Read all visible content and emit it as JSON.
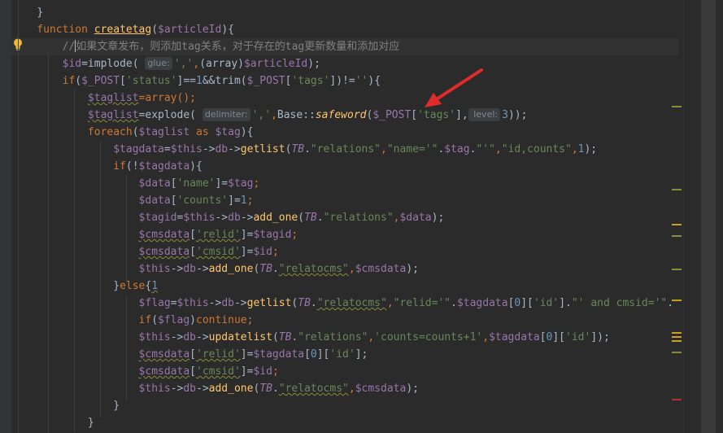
{
  "editor": {
    "lines": [
      {
        "tokens": [
          {
            "t": "    ",
            "c": "plain"
          },
          {
            "t": "}",
            "c": "plain"
          }
        ]
      },
      {
        "tokens": [
          {
            "t": "    ",
            "c": "plain"
          },
          {
            "t": "function ",
            "c": "kw"
          },
          {
            "t": "createtag",
            "c": "ul-fn"
          },
          {
            "t": "(",
            "c": "plain"
          },
          {
            "t": "$articleId",
            "c": "var"
          },
          {
            "t": "){",
            "c": "plain"
          }
        ]
      },
      {
        "current": true,
        "tokens": [
          {
            "t": "        ",
            "c": "plain"
          },
          {
            "t": "//",
            "c": "cmt"
          },
          {
            "t": "CARET",
            "c": "caret"
          },
          {
            "t": "如果文章发布，则添加tag关系，对于存在的tag更新数量和添加对应",
            "c": "cmt"
          }
        ]
      },
      {
        "tokens": [
          {
            "t": "        ",
            "c": "plain"
          },
          {
            "t": "$id",
            "c": "var"
          },
          {
            "t": "=implode( ",
            "c": "plain"
          },
          {
            "t": "glue:",
            "c": "hint"
          },
          {
            "t": "','",
            "c": "str"
          },
          {
            "t": ",",
            "c": "kw"
          },
          {
            "t": "(array)",
            "c": "plain"
          },
          {
            "t": "$articleId",
            "c": "var"
          },
          {
            "t": ");",
            "c": "plain"
          }
        ]
      },
      {
        "tokens": [
          {
            "t": "        ",
            "c": "plain"
          },
          {
            "t": "if",
            "c": "kw"
          },
          {
            "t": "(",
            "c": "plain"
          },
          {
            "t": "$_POST",
            "c": "var"
          },
          {
            "t": "[",
            "c": "plain"
          },
          {
            "t": "'status'",
            "c": "str"
          },
          {
            "t": "]==",
            "c": "plain"
          },
          {
            "t": "1",
            "c": "num"
          },
          {
            "t": "&&trim(",
            "c": "plain"
          },
          {
            "t": "$_POST",
            "c": "var"
          },
          {
            "t": "[",
            "c": "plain"
          },
          {
            "t": "'tags'",
            "c": "str"
          },
          {
            "t": "])!=",
            "c": "plain"
          },
          {
            "t": "''",
            "c": "str"
          },
          {
            "t": "){",
            "c": "plain"
          }
        ]
      },
      {
        "tokens": [
          {
            "t": "            ",
            "c": "plain"
          },
          {
            "t": "$taglist",
            "c": "var squig"
          },
          {
            "t": "=array();",
            "c": "kw"
          }
        ]
      },
      {
        "tokens": [
          {
            "t": "            ",
            "c": "plain"
          },
          {
            "t": "$taglist",
            "c": "var squig"
          },
          {
            "t": "=explode( ",
            "c": "plain"
          },
          {
            "t": "delimiter:",
            "c": "hint"
          },
          {
            "t": "','",
            "c": "str"
          },
          {
            "t": ",",
            "c": "kw"
          },
          {
            "t": "Base::",
            "c": "plain"
          },
          {
            "t": "safeword",
            "c": "ital-fn"
          },
          {
            "t": "(",
            "c": "plain"
          },
          {
            "t": "$_POST",
            "c": "var"
          },
          {
            "t": "[",
            "c": "plain"
          },
          {
            "t": "'tags'",
            "c": "str"
          },
          {
            "t": "],",
            "c": "plain"
          },
          {
            "t": " level:",
            "c": "hint"
          },
          {
            "t": "3",
            "c": "num"
          },
          {
            "t": "));",
            "c": "plain"
          }
        ]
      },
      {
        "tokens": [
          {
            "t": "            ",
            "c": "plain"
          },
          {
            "t": "foreach",
            "c": "kw"
          },
          {
            "t": "(",
            "c": "plain"
          },
          {
            "t": "$taglist",
            "c": "var"
          },
          {
            "t": " as ",
            "c": "kw"
          },
          {
            "t": "$tag",
            "c": "var"
          },
          {
            "t": "){",
            "c": "plain"
          }
        ]
      },
      {
        "tokens": [
          {
            "t": "                ",
            "c": "plain"
          },
          {
            "t": "$tagdata",
            "c": "var"
          },
          {
            "t": "=",
            "c": "plain"
          },
          {
            "t": "$this",
            "c": "var"
          },
          {
            "t": "->",
            "c": "plain"
          },
          {
            "t": "db",
            "c": "var"
          },
          {
            "t": "->",
            "c": "plain"
          },
          {
            "t": "getlist",
            "c": "method"
          },
          {
            "t": "(",
            "c": "plain"
          },
          {
            "t": "TB",
            "c": "const"
          },
          {
            "t": ".",
            "c": "plain"
          },
          {
            "t": "\"relations\"",
            "c": "str"
          },
          {
            "t": ",",
            "c": "kw"
          },
          {
            "t": "\"name='\"",
            "c": "str"
          },
          {
            "t": ".",
            "c": "plain"
          },
          {
            "t": "$tag",
            "c": "var"
          },
          {
            "t": ".",
            "c": "plain"
          },
          {
            "t": "\"'\"",
            "c": "str"
          },
          {
            "t": ",",
            "c": "kw"
          },
          {
            "t": "\"id,counts\"",
            "c": "str"
          },
          {
            "t": ",",
            "c": "kw"
          },
          {
            "t": "1",
            "c": "num"
          },
          {
            "t": ");",
            "c": "plain"
          }
        ]
      },
      {
        "tokens": [
          {
            "t": "                ",
            "c": "plain"
          },
          {
            "t": "if",
            "c": "kw"
          },
          {
            "t": "(!",
            "c": "plain"
          },
          {
            "t": "$tagdata",
            "c": "var"
          },
          {
            "t": "){",
            "c": "plain"
          }
        ]
      },
      {
        "tokens": [
          {
            "t": "                    ",
            "c": "plain"
          },
          {
            "t": "$data",
            "c": "var"
          },
          {
            "t": "[",
            "c": "plain"
          },
          {
            "t": "'name'",
            "c": "str"
          },
          {
            "t": "]=",
            "c": "plain"
          },
          {
            "t": "$tag",
            "c": "var"
          },
          {
            "t": ";",
            "c": "kw"
          }
        ]
      },
      {
        "tokens": [
          {
            "t": "                    ",
            "c": "plain"
          },
          {
            "t": "$data",
            "c": "var"
          },
          {
            "t": "[",
            "c": "plain"
          },
          {
            "t": "'counts'",
            "c": "str"
          },
          {
            "t": "]=",
            "c": "plain"
          },
          {
            "t": "1",
            "c": "num"
          },
          {
            "t": ";",
            "c": "kw"
          }
        ]
      },
      {
        "tokens": [
          {
            "t": "                    ",
            "c": "plain"
          },
          {
            "t": "$tagid",
            "c": "var"
          },
          {
            "t": "=",
            "c": "plain"
          },
          {
            "t": "$this",
            "c": "var"
          },
          {
            "t": "->",
            "c": "plain"
          },
          {
            "t": "db",
            "c": "var"
          },
          {
            "t": "->",
            "c": "plain"
          },
          {
            "t": "add_one",
            "c": "method"
          },
          {
            "t": "(",
            "c": "plain"
          },
          {
            "t": "TB",
            "c": "const"
          },
          {
            "t": ".",
            "c": "plain"
          },
          {
            "t": "\"relations\"",
            "c": "str"
          },
          {
            "t": ",",
            "c": "kw"
          },
          {
            "t": "$data",
            "c": "var"
          },
          {
            "t": ");",
            "c": "plain"
          }
        ]
      },
      {
        "tokens": [
          {
            "t": "                    ",
            "c": "plain"
          },
          {
            "t": "$cmsdata",
            "c": "var squig"
          },
          {
            "t": "[",
            "c": "plain"
          },
          {
            "t": "'relid'",
            "c": "str squig"
          },
          {
            "t": "]=",
            "c": "plain"
          },
          {
            "t": "$tagid",
            "c": "var"
          },
          {
            "t": ";",
            "c": "kw"
          }
        ]
      },
      {
        "tokens": [
          {
            "t": "                    ",
            "c": "plain"
          },
          {
            "t": "$cmsdata",
            "c": "var squig"
          },
          {
            "t": "[",
            "c": "plain"
          },
          {
            "t": "'cmsid'",
            "c": "str squig"
          },
          {
            "t": "]=",
            "c": "plain"
          },
          {
            "t": "$id",
            "c": "var"
          },
          {
            "t": ";",
            "c": "kw"
          }
        ]
      },
      {
        "tokens": [
          {
            "t": "                    ",
            "c": "plain"
          },
          {
            "t": "$this",
            "c": "var"
          },
          {
            "t": "->",
            "c": "plain"
          },
          {
            "t": "db",
            "c": "var"
          },
          {
            "t": "->",
            "c": "plain"
          },
          {
            "t": "add_one",
            "c": "method"
          },
          {
            "t": "(",
            "c": "plain"
          },
          {
            "t": "TB",
            "c": "const"
          },
          {
            "t": ".",
            "c": "plain"
          },
          {
            "t": "\"relatocms\"",
            "c": "str squig"
          },
          {
            "t": ",",
            "c": "kw"
          },
          {
            "t": "$cmsdata",
            "c": "var"
          },
          {
            "t": ");",
            "c": "plain"
          }
        ]
      },
      {
        "tokens": [
          {
            "t": "                ",
            "c": "plain"
          },
          {
            "t": "}",
            "c": "plain"
          },
          {
            "t": "else",
            "c": "kw"
          },
          {
            "t": "{",
            "c": "plain"
          },
          {
            "t": "1",
            "c": "num squig"
          }
        ]
      },
      {
        "tokens": [
          {
            "t": "                    ",
            "c": "plain"
          },
          {
            "t": "$flag",
            "c": "var"
          },
          {
            "t": "=",
            "c": "plain"
          },
          {
            "t": "$this",
            "c": "var"
          },
          {
            "t": "->",
            "c": "plain"
          },
          {
            "t": "db",
            "c": "var"
          },
          {
            "t": "->",
            "c": "plain"
          },
          {
            "t": "getlist",
            "c": "method"
          },
          {
            "t": "(",
            "c": "plain"
          },
          {
            "t": "TB",
            "c": "const"
          },
          {
            "t": ".",
            "c": "plain"
          },
          {
            "t": "\"relatocms\"",
            "c": "str squig"
          },
          {
            "t": ",",
            "c": "kw"
          },
          {
            "t": "\"relid='\"",
            "c": "str"
          },
          {
            "t": ".",
            "c": "plain"
          },
          {
            "t": "$tagdata",
            "c": "var"
          },
          {
            "t": "[",
            "c": "plain"
          },
          {
            "t": "0",
            "c": "num"
          },
          {
            "t": "][",
            "c": "plain"
          },
          {
            "t": "'id'",
            "c": "str"
          },
          {
            "t": "].",
            "c": "plain"
          },
          {
            "t": "\"' and cmsid='\"",
            "c": "str"
          },
          {
            "t": ".",
            "c": "plain"
          }
        ]
      },
      {
        "tokens": [
          {
            "t": "                    ",
            "c": "plain"
          },
          {
            "t": "if",
            "c": "kw"
          },
          {
            "t": "(",
            "c": "plain"
          },
          {
            "t": "$flag",
            "c": "var"
          },
          {
            "t": ")",
            "c": "plain"
          },
          {
            "t": "continue;",
            "c": "kw"
          }
        ]
      },
      {
        "tokens": [
          {
            "t": "                    ",
            "c": "plain"
          },
          {
            "t": "$this",
            "c": "var"
          },
          {
            "t": "->",
            "c": "plain"
          },
          {
            "t": "db",
            "c": "var"
          },
          {
            "t": "->",
            "c": "plain"
          },
          {
            "t": "updatelist",
            "c": "method"
          },
          {
            "t": "(",
            "c": "plain"
          },
          {
            "t": "TB",
            "c": "const"
          },
          {
            "t": ".",
            "c": "plain"
          },
          {
            "t": "\"relations\"",
            "c": "str"
          },
          {
            "t": ",",
            "c": "kw"
          },
          {
            "t": "'counts=counts+1'",
            "c": "str"
          },
          {
            "t": ",",
            "c": "kw"
          },
          {
            "t": "$tagdata",
            "c": "var"
          },
          {
            "t": "[",
            "c": "plain"
          },
          {
            "t": "0",
            "c": "num"
          },
          {
            "t": "][",
            "c": "plain"
          },
          {
            "t": "'id'",
            "c": "str"
          },
          {
            "t": "]);",
            "c": "plain"
          }
        ]
      },
      {
        "tokens": [
          {
            "t": "                    ",
            "c": "plain"
          },
          {
            "t": "$cmsdata",
            "c": "var squig"
          },
          {
            "t": "[",
            "c": "plain"
          },
          {
            "t": "'relid'",
            "c": "str squig"
          },
          {
            "t": "]=",
            "c": "plain"
          },
          {
            "t": "$tagdata",
            "c": "var"
          },
          {
            "t": "[",
            "c": "plain"
          },
          {
            "t": "0",
            "c": "num"
          },
          {
            "t": "][",
            "c": "plain"
          },
          {
            "t": "'id'",
            "c": "str"
          },
          {
            "t": "];",
            "c": "plain"
          }
        ]
      },
      {
        "tokens": [
          {
            "t": "                    ",
            "c": "plain"
          },
          {
            "t": "$cmsdata",
            "c": "var squig"
          },
          {
            "t": "[",
            "c": "plain"
          },
          {
            "t": "'cmsid'",
            "c": "str squig"
          },
          {
            "t": "]=",
            "c": "plain"
          },
          {
            "t": "$id",
            "c": "var"
          },
          {
            "t": ";",
            "c": "kw"
          }
        ]
      },
      {
        "tokens": [
          {
            "t": "                    ",
            "c": "plain"
          },
          {
            "t": "$this",
            "c": "var"
          },
          {
            "t": "->",
            "c": "plain"
          },
          {
            "t": "db",
            "c": "var"
          },
          {
            "t": "->",
            "c": "plain"
          },
          {
            "t": "add_one",
            "c": "method"
          },
          {
            "t": "(",
            "c": "plain"
          },
          {
            "t": "TB",
            "c": "const"
          },
          {
            "t": ".",
            "c": "plain"
          },
          {
            "t": "\"relatocms\"",
            "c": "str squig"
          },
          {
            "t": ",",
            "c": "kw"
          },
          {
            "t": "$cmsdata",
            "c": "var"
          },
          {
            "t": ");",
            "c": "plain"
          }
        ]
      },
      {
        "tokens": [
          {
            "t": "                ",
            "c": "plain"
          },
          {
            "t": "}",
            "c": "plain"
          }
        ]
      },
      {
        "tokens": [
          {
            "t": "            ",
            "c": "plain"
          },
          {
            "t": "}",
            "c": "plain"
          }
        ]
      }
    ]
  },
  "colors": {
    "background": "#2b2b2b",
    "keyword": "#cc7832",
    "variable": "#9876aa",
    "string": "#6a8759",
    "number": "#6897bb",
    "function": "#ffc66d",
    "arrow": "#e02b2b"
  },
  "icons": {
    "intention_bulb": "lightbulb-icon",
    "annotation_arrow": "red-arrow-icon"
  }
}
